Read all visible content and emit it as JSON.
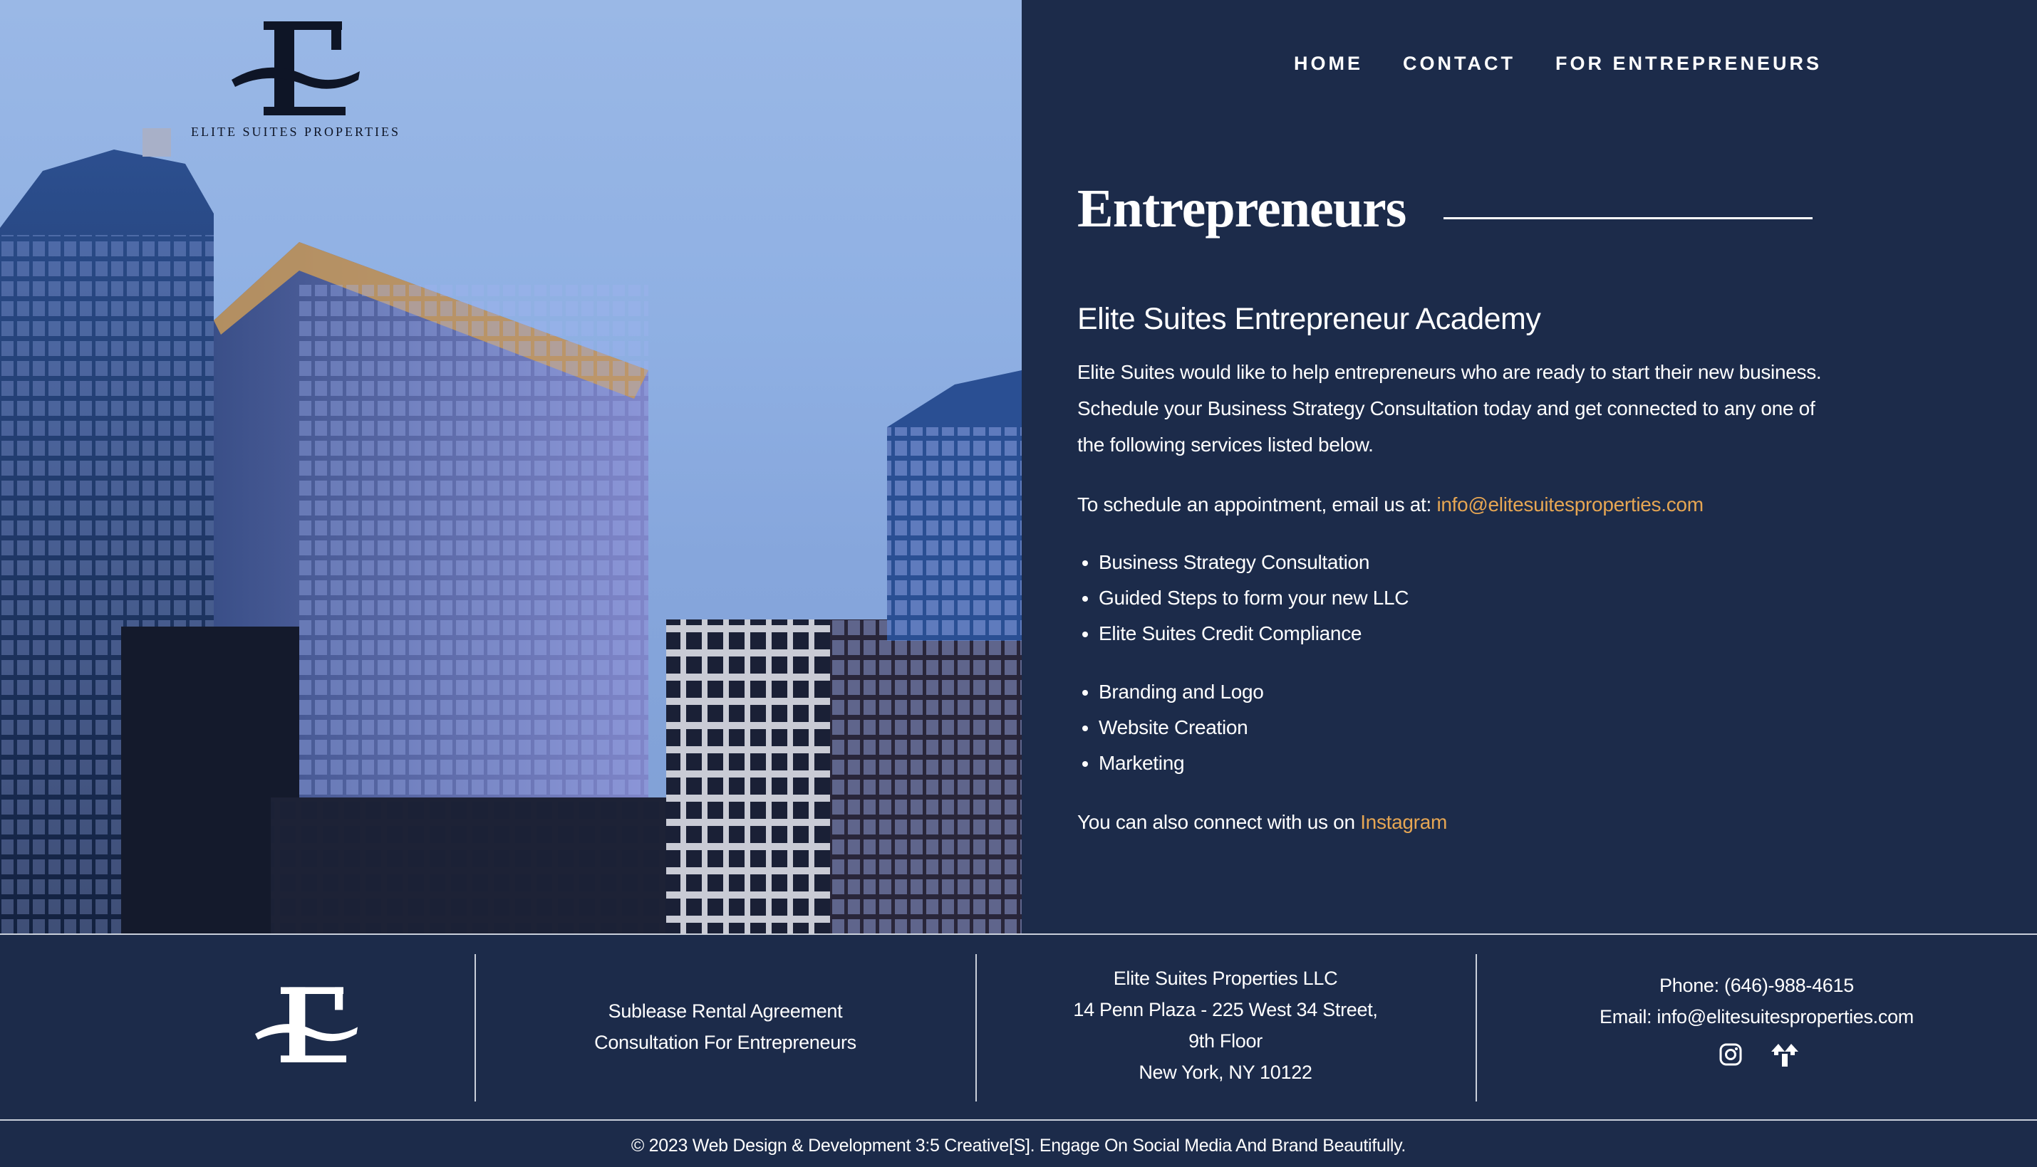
{
  "brand": {
    "logo_wordmark": "ELITE SUITES PROPERTIES"
  },
  "nav": {
    "items": [
      "HOME",
      "CONTACT",
      "FOR ENTREPRENEURS"
    ]
  },
  "main": {
    "title": "Entrepreneurs",
    "heading": "Elite Suites Entrepreneur Academy",
    "intro": "Elite Suites would like to help entrepreneurs who are ready to start their new business. Schedule your Business Strategy Consultation today and get connected to any one of the following services listed below.",
    "schedule_prefix": "To schedule an appointment, email us at:",
    "schedule_email": "info@elitesuitesproperties.com",
    "services_group1": [
      "Business Strategy Consultation",
      "Guided Steps to form your new LLC",
      "Elite Suites Credit Compliance"
    ],
    "services_group2": [
      "Branding and Logo",
      "Website Creation",
      "Marketing"
    ],
    "connect_prefix": "You can also connect with us on",
    "connect_link": "Instagram"
  },
  "footer": {
    "links": [
      "Sublease Rental Agreement",
      "Consultation For Entrepreneurs"
    ],
    "address": [
      "Elite Suites Properties LLC",
      "14 Penn Plaza - 225 West 34 Street,",
      "9th Floor",
      "New York, NY 10122"
    ],
    "phone": "Phone: (646)-988-4615",
    "email": "Email: info@elitesuitesproperties.com",
    "social_icons": [
      "instagram-icon",
      "linktree-icon"
    ],
    "copyright": "© 2023 Web Design & Development 3:5 Creative[S]. Engage On Social Media And Brand Beautifully."
  },
  "colors": {
    "panel_bg": "#1c2b4a",
    "accent_link": "#e6a653",
    "text": "#ffffff"
  }
}
